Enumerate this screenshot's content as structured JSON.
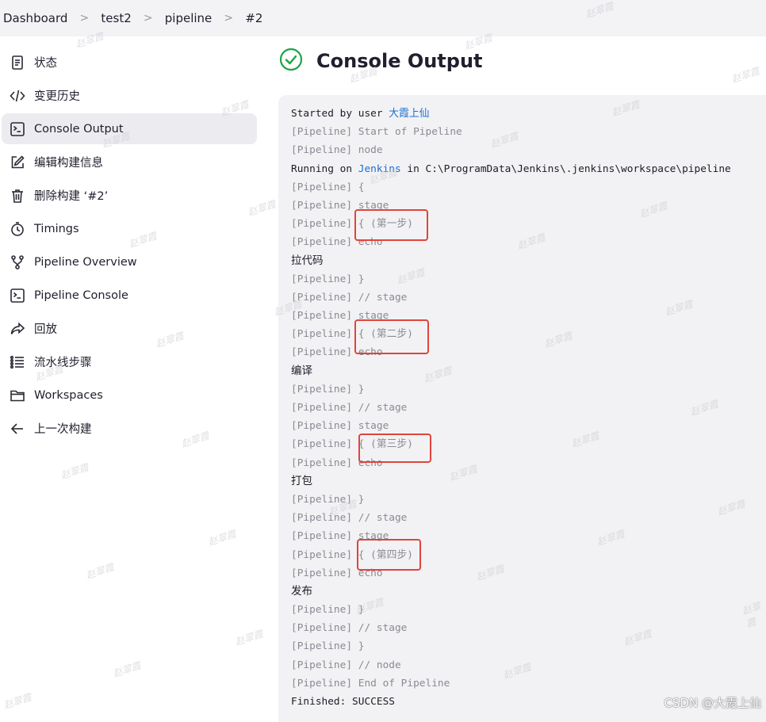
{
  "breadcrumb": {
    "items": [
      "Dashboard",
      "test2",
      "pipeline",
      "#2"
    ],
    "separator": ">"
  },
  "sidebar": {
    "items": [
      {
        "label": "状态",
        "icon": "status-doc-icon"
      },
      {
        "label": "变更历史",
        "icon": "code-icon"
      },
      {
        "label": "Console Output",
        "icon": "terminal-icon",
        "active": true
      },
      {
        "label": "编辑构建信息",
        "icon": "edit-icon"
      },
      {
        "label": "删除构建 ‘#2’",
        "icon": "trash-icon"
      },
      {
        "label": "Timings",
        "icon": "clock-icon"
      },
      {
        "label": "Pipeline Overview",
        "icon": "branch-icon"
      },
      {
        "label": "Pipeline Console",
        "icon": "terminal-icon"
      },
      {
        "label": "回放",
        "icon": "replay-icon"
      },
      {
        "label": "流水线步骤",
        "icon": "list-icon"
      },
      {
        "label": "Workspaces",
        "icon": "folder-icon"
      },
      {
        "label": "上一次构建",
        "icon": "arrow-left-icon"
      }
    ]
  },
  "header": {
    "title": "Console Output",
    "status_icon": "success-check-icon",
    "status_color": "#1ea446"
  },
  "console": {
    "started_prefix": "Started by user ",
    "started_user": "大霞上仙",
    "running_prefix": "Running on ",
    "running_node": "Jenkins",
    "running_suffix": " in C:\\ProgramData\\Jenkins\\.jenkins\\workspace\\pipeline",
    "lines": [
      "[Pipeline] Start of Pipeline",
      "[Pipeline] node",
      "[Pipeline] {",
      "[Pipeline] stage",
      "[Pipeline] { (第一步)",
      "[Pipeline] echo",
      "拉代码",
      "[Pipeline] }",
      "[Pipeline] // stage",
      "[Pipeline] stage",
      "[Pipeline] { (第二步)",
      "[Pipeline] echo",
      "编译",
      "[Pipeline] }",
      "[Pipeline] // stage",
      "[Pipeline] stage",
      "[Pipeline] { (第三步)",
      "[Pipeline] echo",
      "打包",
      "[Pipeline] }",
      "[Pipeline] // stage",
      "[Pipeline] stage",
      "[Pipeline] { (第四步)",
      "[Pipeline] echo",
      "发布",
      "[Pipeline] }",
      "[Pipeline] // stage",
      "[Pipeline] }",
      "[Pipeline] // node",
      "[Pipeline] End of Pipeline"
    ],
    "finished": "Finished: SUCCESS"
  },
  "highlight_color": "#e0443c",
  "link_color": "#1a6fd1",
  "watermark_text": "赵翠霞",
  "footer_watermark": "CSDN @大霞上仙"
}
